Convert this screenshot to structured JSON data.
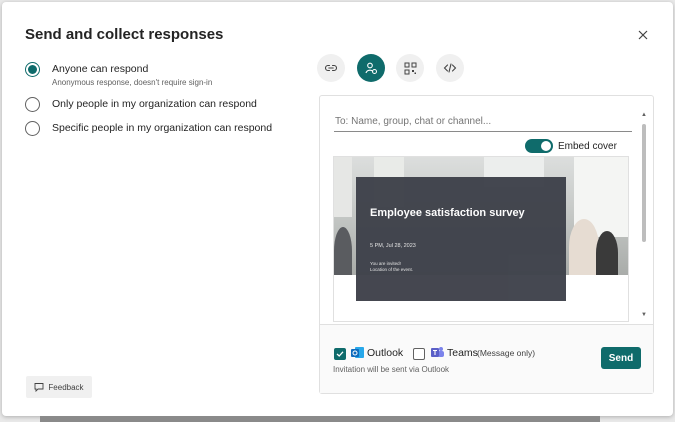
{
  "dialog": {
    "title": "Send and collect responses"
  },
  "response_options": [
    {
      "label": "Anyone can respond",
      "sublabel": "Anonymous response, doesn't require sign-in",
      "checked": true
    },
    {
      "label": "Only people in my organization can respond",
      "sublabel": "",
      "checked": false
    },
    {
      "label": "Specific people in my organization can respond",
      "sublabel": "",
      "checked": false
    }
  ],
  "share_methods": [
    {
      "icon": "link-icon",
      "active": false
    },
    {
      "icon": "invite-people-icon",
      "active": true
    },
    {
      "icon": "qr-code-icon",
      "active": false
    },
    {
      "icon": "embed-code-icon",
      "active": false
    }
  ],
  "invite": {
    "to_placeholder": "To: Name, group, chat or channel...",
    "embed_cover_label": "Embed cover",
    "embed_cover_on": true
  },
  "preview": {
    "card_title": "Employee satisfaction survey",
    "card_date": "5 PM, Jul 28, 2023",
    "card_invite_line1": "You are invited!",
    "card_invite_line2": "Location of the event."
  },
  "footer": {
    "outlook_label": "Outlook",
    "outlook_checked": true,
    "teams_label": "Teams",
    "teams_note": "(Message only)",
    "teams_checked": false,
    "note": "Invitation will be sent via Outlook",
    "send_label": "Send"
  },
  "feedback_label": "Feedback",
  "colors": {
    "accent": "#0f6b6b",
    "card_bg": "#3f424b",
    "outlook_blue": "#0f6cbd",
    "teams_purple": "#5b5fc7"
  }
}
